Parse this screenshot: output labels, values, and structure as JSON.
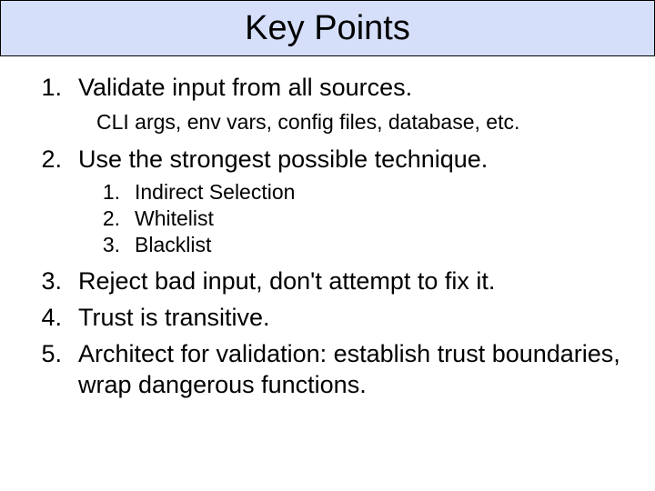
{
  "title": "Key Points",
  "items": [
    {
      "n": "1.",
      "text": "Validate input from all sources."
    },
    {
      "n": "2.",
      "text": "Use the strongest possible technique."
    },
    {
      "n": "3.",
      "text": "Reject bad input, don't attempt to fix it."
    },
    {
      "n": "4.",
      "text": "Trust is transitive."
    },
    {
      "n": "5.",
      "text": "Architect for validation: establish trust boundaries, wrap dangerous functions."
    }
  ],
  "item1_sub": "CLI args, env vars, config files, database, etc.",
  "item2_sub": [
    {
      "n": "1.",
      "text": "Indirect Selection"
    },
    {
      "n": "2.",
      "text": "Whitelist"
    },
    {
      "n": "3.",
      "text": "Blacklist"
    }
  ]
}
